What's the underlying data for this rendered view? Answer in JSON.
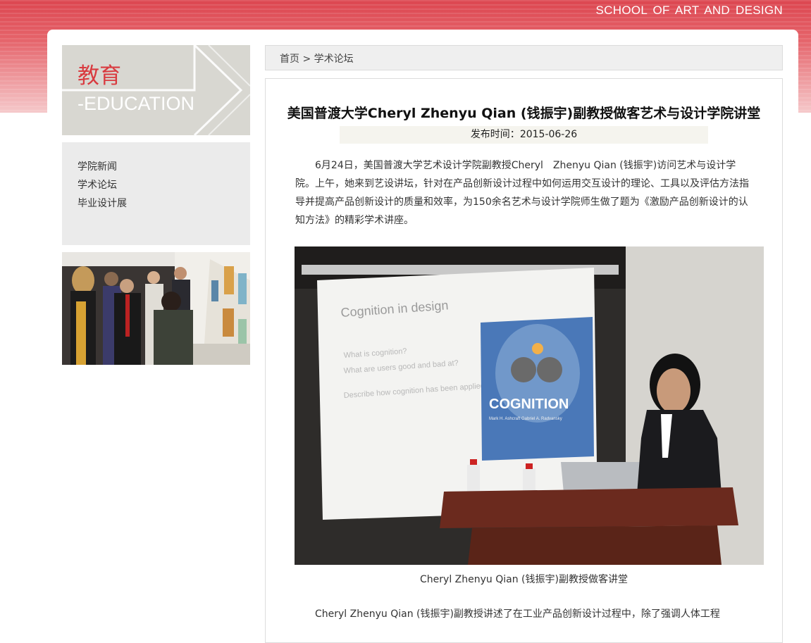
{
  "header": {
    "school_name": "SCHOOL OF ART AND DESIGN"
  },
  "sidebar": {
    "section_title_cn": "教育",
    "section_title_en": "-EDUCATION",
    "nav_items": [
      {
        "label": "学院新闻"
      },
      {
        "label": "学术论坛"
      },
      {
        "label": "毕业设计展"
      }
    ]
  },
  "breadcrumb": {
    "home": "首页",
    "separator": ">",
    "current": "学术论坛"
  },
  "article": {
    "title": "美国普渡大学Cheryl Zhenyu Qian (钱振宇)副教授做客艺术与设计学院讲堂",
    "publish_label": "发布时间：",
    "publish_date": "2015-06-26",
    "paragraph1": "6月24日，美国普渡大学艺术设计学院副教授Cheryl　Zhenyu Qian (钱振宇)访问艺术与设计学院。上午，她来到艺设讲坛，针对在产品创新设计过程中如何运用交互设计的理论、工具以及评估方法指导并提高产品创新设计的质量和效率，为150余名艺术与设计学院师生做了题为《激励产品创新设计的认知方法》的精彩学术讲座。",
    "photo": {
      "slide_title": "Cognition in design",
      "slide_bullets": [
        "What is cognition?",
        "What are users good and bad at?",
        "Describe how cognition has been applied to design"
      ],
      "book_title": "COGNITION",
      "book_authors": "Mark H. Ashcraft   Gabriel A. Radvansky"
    },
    "caption": "Cheryl Zhenyu Qian (钱振宇)副教授做客讲堂",
    "paragraph2": "Cheryl Zhenyu Qian (钱振宇)副教授讲述了在工业产品创新设计过程中，除了强调人体工程"
  },
  "colors": {
    "header_red": "#dc4650",
    "accent_red": "#d93a3f",
    "banner_gray": "#d8d7d1",
    "nav_bg": "#ebebeb"
  }
}
